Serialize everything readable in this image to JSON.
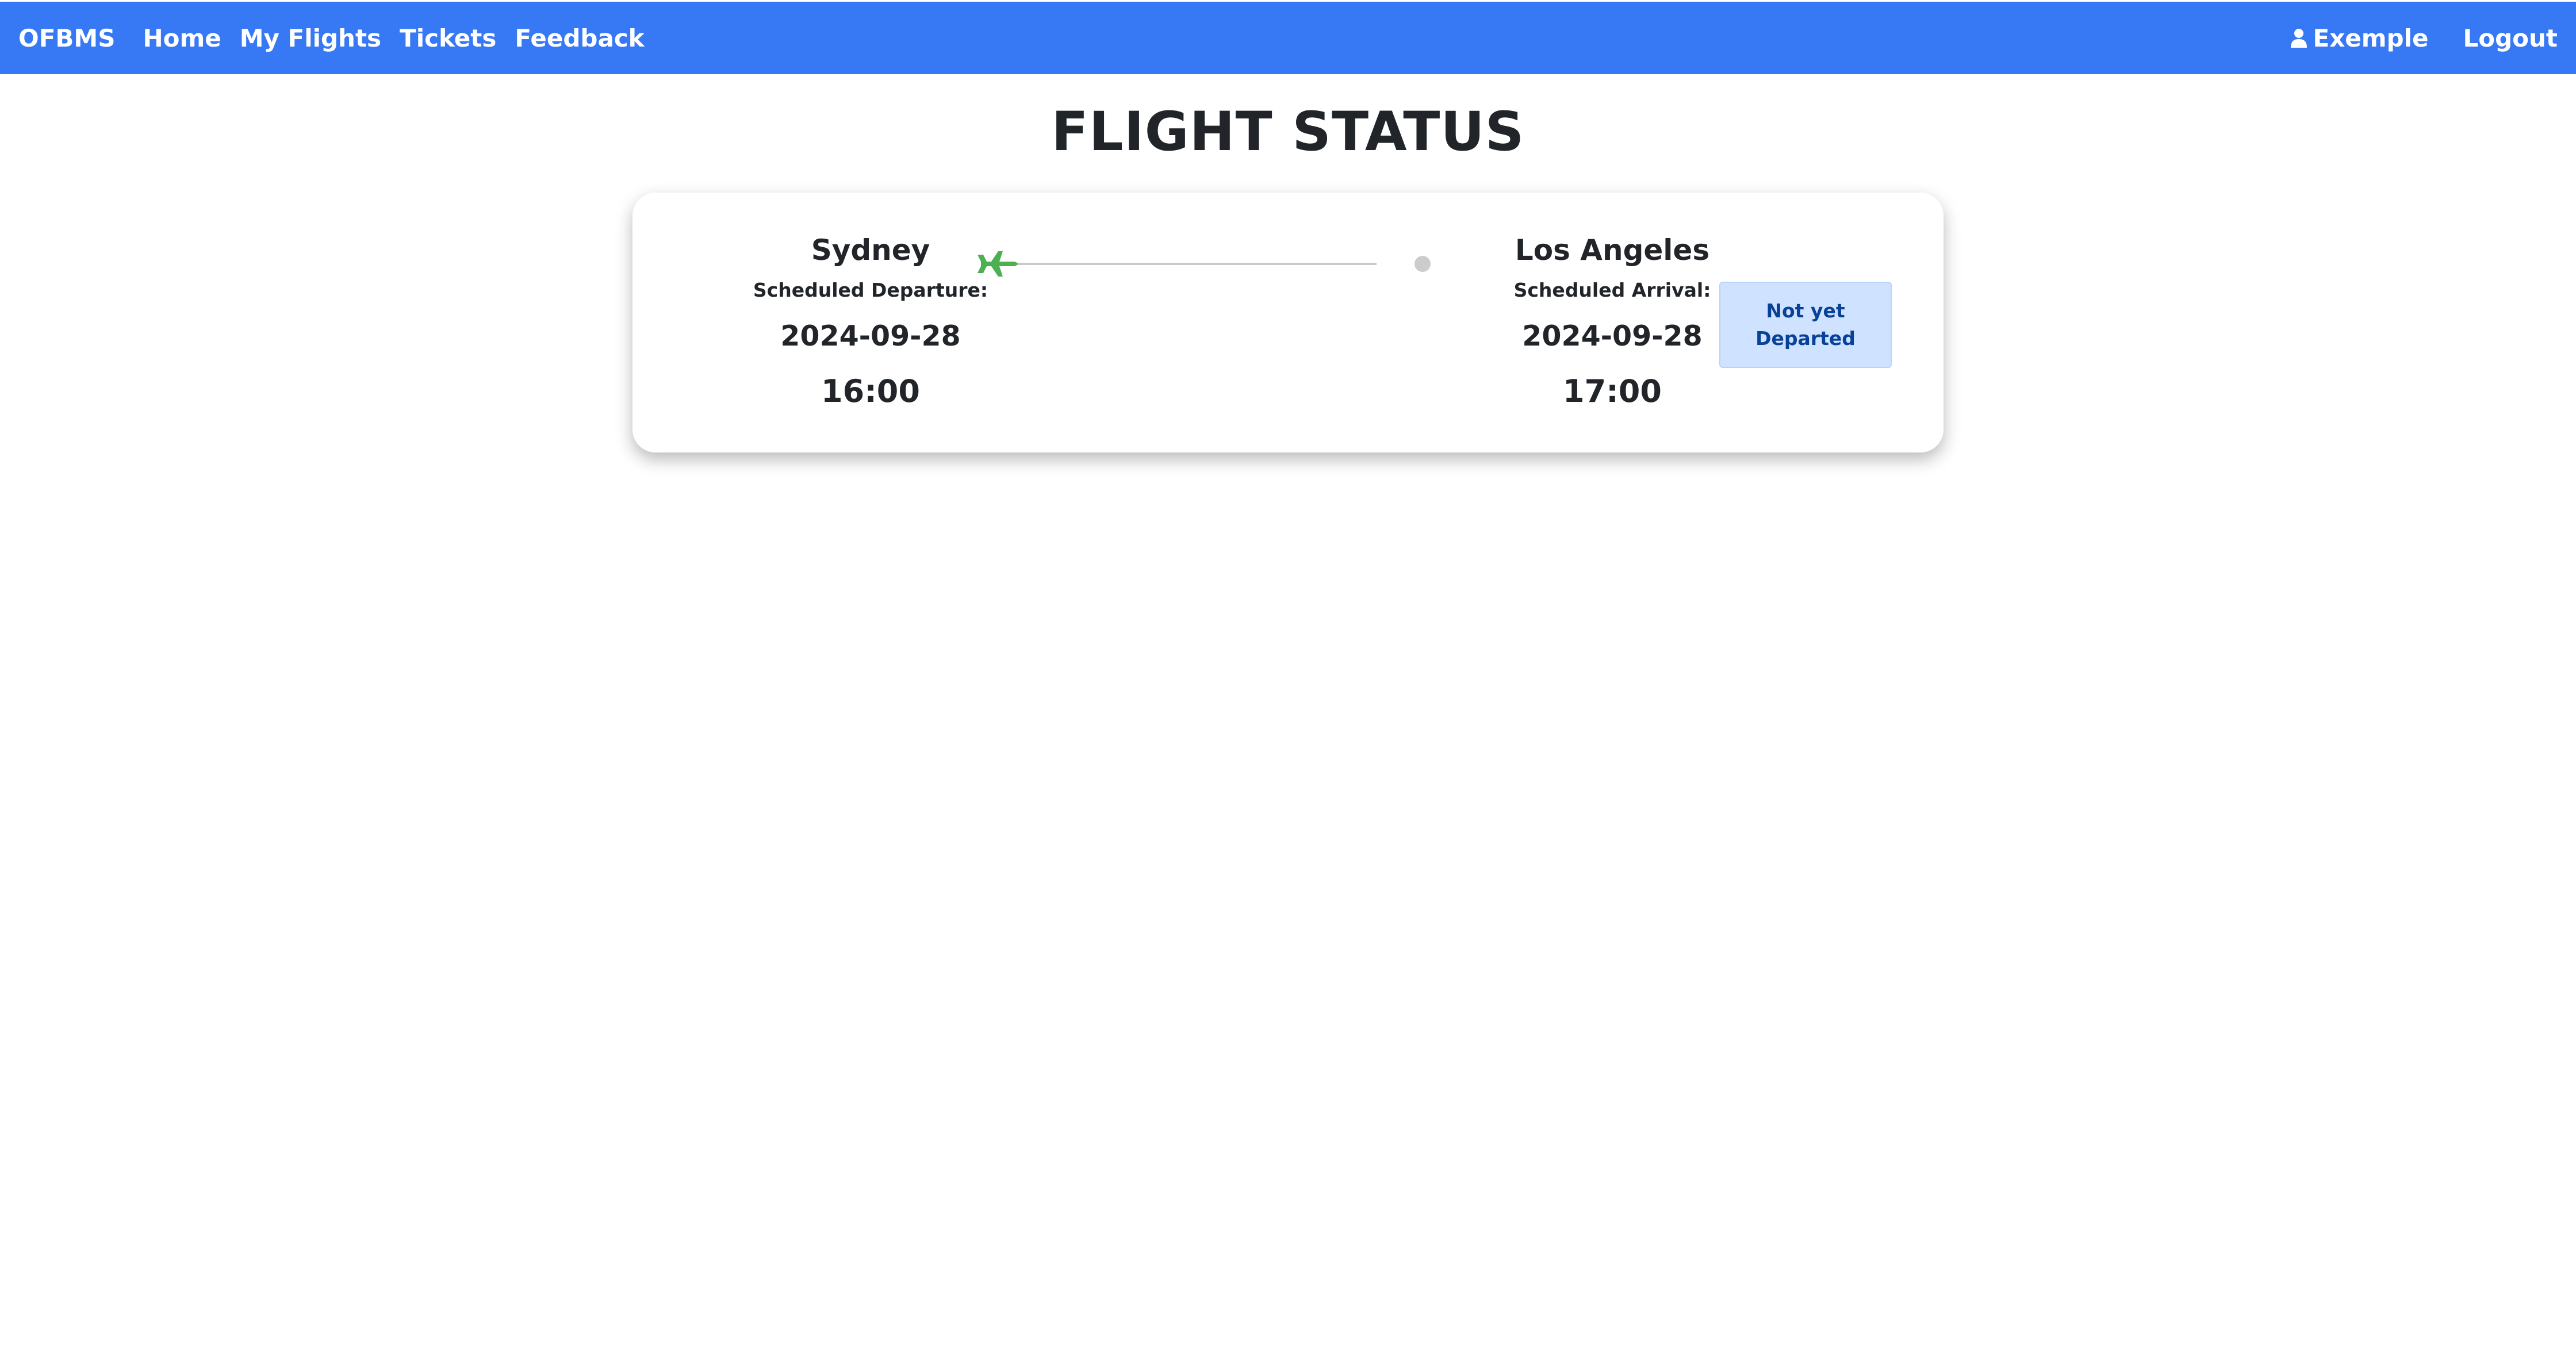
{
  "navbar": {
    "brand": "OFBMS",
    "links": [
      "Home",
      "My Flights",
      "Tickets",
      "Feedback"
    ],
    "user_name": "Exemple",
    "user_icon": "user-icon",
    "logout": "Logout",
    "background_color": "#3779f4"
  },
  "page": {
    "title": "FLIGHT STATUS"
  },
  "flight": {
    "departure": {
      "city": "Sydney",
      "label": "Scheduled Departure:",
      "date": "2024-09-28",
      "time": "16:00"
    },
    "arrival": {
      "city": "Los Angeles",
      "label": "Scheduled Arrival:",
      "date": "2024-09-28",
      "time": "17:00"
    },
    "progress": 0,
    "plane_icon": "airplane-icon",
    "plane_color": "#4caf50",
    "status": "Not yet Departed",
    "status_color": "#cfe2ff"
  }
}
